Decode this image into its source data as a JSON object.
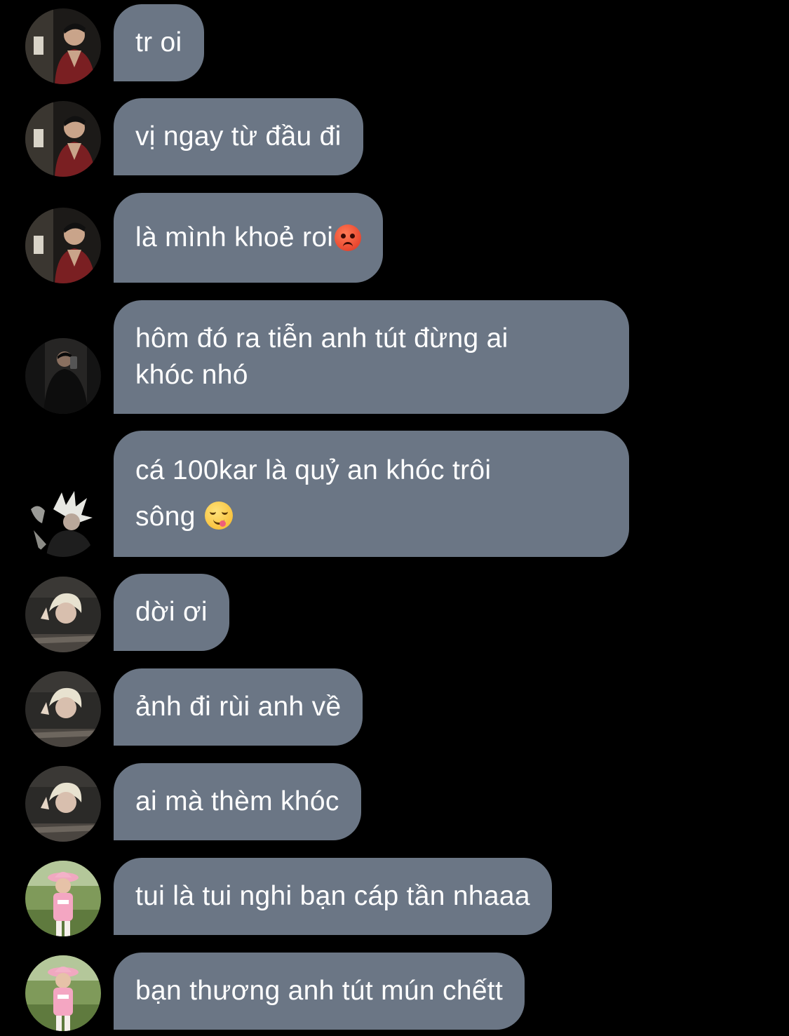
{
  "messages": [
    {
      "text": "tr oi",
      "avatar": "avatar-user-a"
    },
    {
      "text": "vị ngay từ đầu đi",
      "avatar": "avatar-user-a"
    },
    {
      "text": "là mình khoẻ roi",
      "emoji": "angry-face-emoji",
      "avatar": "avatar-user-a"
    },
    {
      "text": "hôm đó ra tiễn anh tút đừng ai\nkhóc nhó",
      "avatar": "avatar-user-b"
    },
    {
      "text": "cá 100kar là quỷ an khóc trôi\nsông ",
      "emoji": "yum-face-emoji",
      "avatar": "avatar-user-c"
    },
    {
      "text": "dời ơi",
      "avatar": "avatar-user-d"
    },
    {
      "text": "ảnh đi rùi anh về",
      "avatar": "avatar-user-d"
    },
    {
      "text": "ai mà thèm khóc",
      "avatar": "avatar-user-d"
    },
    {
      "text": "tui là tui nghi bạn cáp tần nhaaa",
      "avatar": "avatar-user-e"
    },
    {
      "text": "bạn thương anh tút mún chếtt",
      "avatar": "avatar-user-e"
    }
  ],
  "colors": {
    "background": "#000000",
    "bubble": "#6b7685",
    "text": "#ffffff"
  }
}
